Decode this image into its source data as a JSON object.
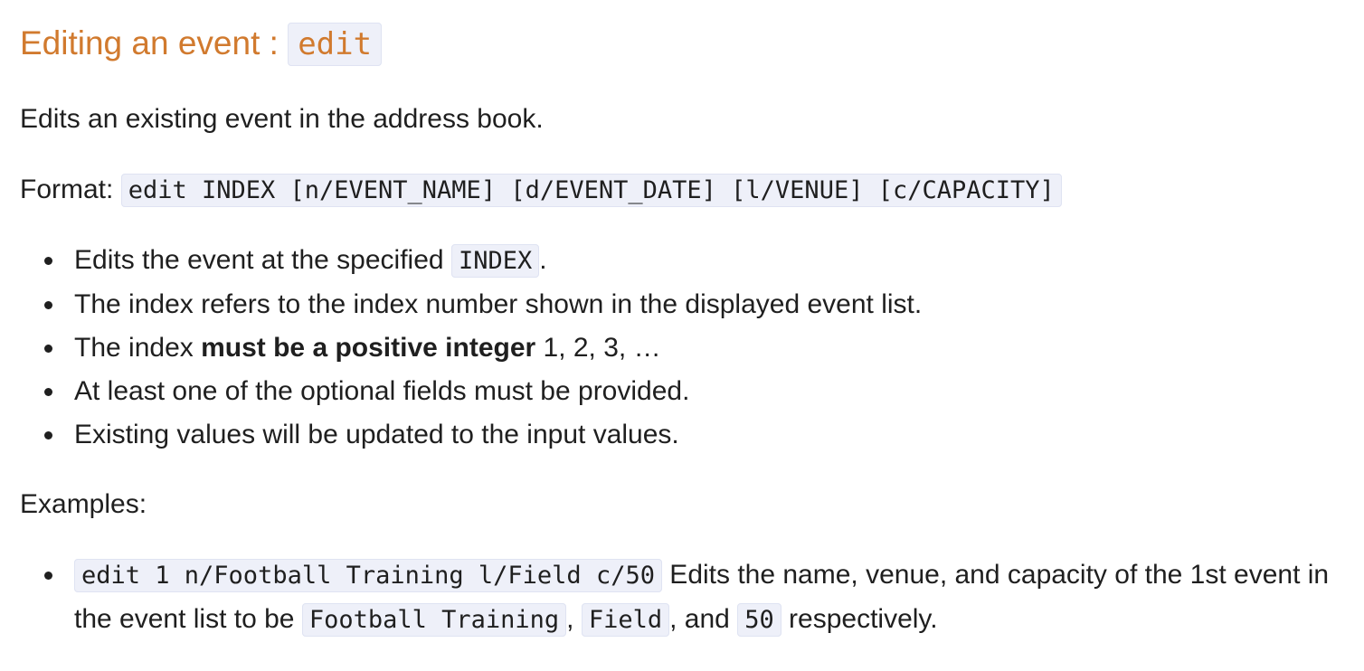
{
  "heading": {
    "text": "Editing an event : ",
    "command": "edit"
  },
  "intro": "Edits an existing event in the address book.",
  "format": {
    "label": "Format: ",
    "syntax": "edit INDEX [n/EVENT_NAME] [d/EVENT_DATE] [l/VENUE] [c/CAPACITY]"
  },
  "notes": {
    "item1": {
      "before": "Edits the event at the specified ",
      "code": "INDEX",
      "after": "."
    },
    "item2": "The index refers to the index number shown in the displayed event list.",
    "item3": {
      "before": "The index ",
      "bold": "must be a positive integer",
      "after": " 1, 2, 3, …"
    },
    "item4": "At least one of the optional fields must be provided.",
    "item5": "Existing values will be updated to the input values."
  },
  "examples": {
    "label": "Examples:",
    "item1": {
      "command": "edit 1 n/Football Training l/Field c/50",
      "text1": " Edits the name, venue, and capacity of the 1st event in the event list to be ",
      "code1": "Football Training",
      "text2": ", ",
      "code2": "Field",
      "text3": ", and ",
      "code3": "50",
      "text4": " respectively."
    }
  }
}
